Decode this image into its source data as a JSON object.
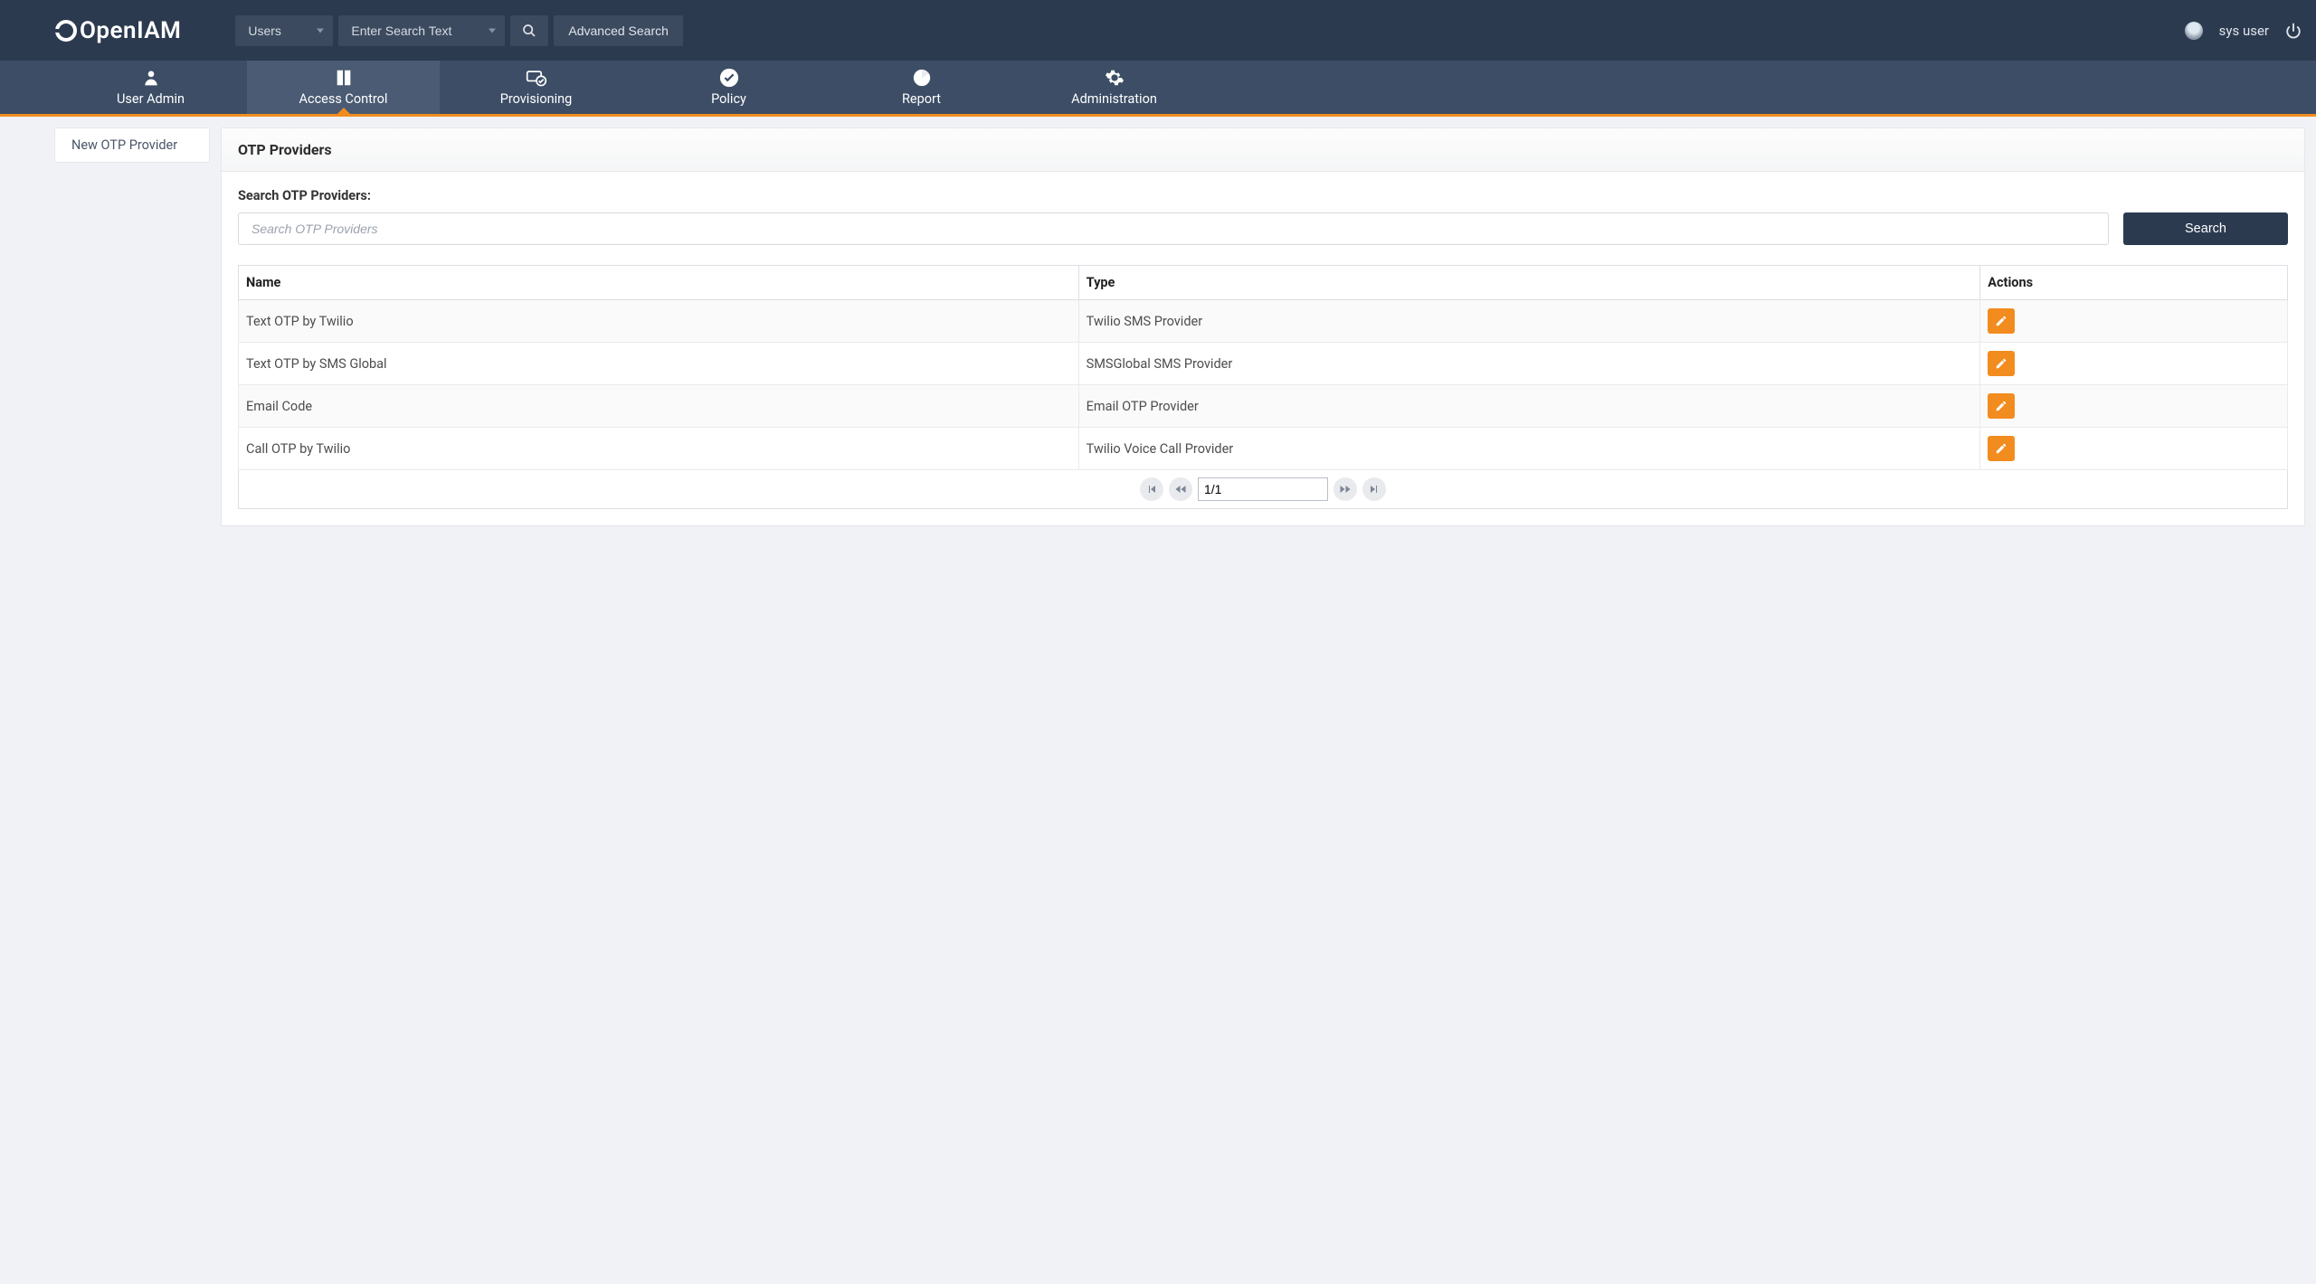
{
  "brand": "OpenIAM",
  "topbar": {
    "search_category": "Users",
    "search_text_placeholder": "Enter Search Text",
    "advanced_search": "Advanced Search",
    "username": "sys user"
  },
  "nav": {
    "items": [
      {
        "label": "User Admin"
      },
      {
        "label": "Access Control"
      },
      {
        "label": "Provisioning"
      },
      {
        "label": "Policy"
      },
      {
        "label": "Report"
      },
      {
        "label": "Administration"
      }
    ],
    "active_index": 1
  },
  "sidebar": {
    "items": [
      {
        "label": "New OTP Provider"
      }
    ]
  },
  "main": {
    "title": "OTP Providers",
    "search_label": "Search OTP Providers:",
    "search_placeholder": "Search OTP Providers",
    "search_button": "Search",
    "columns": {
      "name": "Name",
      "type": "Type",
      "actions": "Actions"
    },
    "rows": [
      {
        "name": "Text OTP by Twilio",
        "type": "Twilio SMS Provider"
      },
      {
        "name": "Text OTP by SMS Global",
        "type": "SMSGlobal SMS Provider"
      },
      {
        "name": "Email Code",
        "type": "Email OTP Provider"
      },
      {
        "name": "Call OTP by Twilio",
        "type": "Twilio Voice Call Provider"
      }
    ],
    "pagination": {
      "value": "1/1"
    }
  }
}
